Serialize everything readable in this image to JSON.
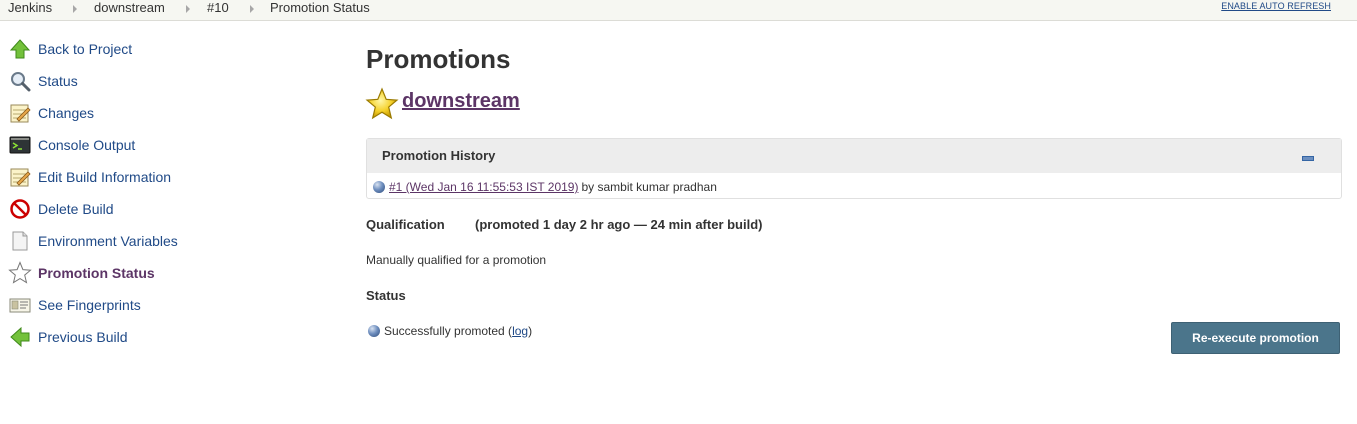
{
  "breadcrumb": {
    "items": [
      "Jenkins",
      "downstream",
      "#10",
      "Promotion Status"
    ],
    "auto_refresh": "ENABLE AUTO REFRESH"
  },
  "sidebar": {
    "items": [
      {
        "label": "Back to Project",
        "icon": "up-arrow-icon",
        "active": false
      },
      {
        "label": "Status",
        "icon": "magnifier-icon",
        "active": false
      },
      {
        "label": "Changes",
        "icon": "notepad-icon",
        "active": false
      },
      {
        "label": "Console Output",
        "icon": "terminal-icon",
        "active": false
      },
      {
        "label": "Edit Build Information",
        "icon": "notepad-pencil-icon",
        "active": false
      },
      {
        "label": "Delete Build",
        "icon": "no-entry-icon",
        "active": false
      },
      {
        "label": "Environment Variables",
        "icon": "document-icon",
        "active": false
      },
      {
        "label": "Promotion Status",
        "icon": "star-outline-icon",
        "active": true
      },
      {
        "label": "See Fingerprints",
        "icon": "fingerprint-card-icon",
        "active": false
      },
      {
        "label": "Previous Build",
        "icon": "left-arrow-icon",
        "active": false
      }
    ]
  },
  "main": {
    "title": "Promotions",
    "process": {
      "name": "downstream",
      "icon": "gold-star-icon"
    },
    "history": {
      "title": "Promotion History",
      "entry_link": "#1 (Wed Jan 16 11:55:53 IST 2019) ",
      "entry_by": "by sambit kumar pradhan"
    },
    "qualification": {
      "label": "Qualification",
      "info": "(promoted 1 day 2 hr ago — 24 min after build)"
    },
    "manual_text": "Manually qualified for a promotion",
    "status": {
      "heading": "Status",
      "text_before": "Successfully promoted (",
      "log_link": "log",
      "text_after": ")"
    },
    "reexecute_label": "Re-execute promotion"
  },
  "colors": {
    "link": "#204a87",
    "visited_link": "#5c3566",
    "button_bg": "#4b758b",
    "panel_header_bg": "#ededed"
  }
}
